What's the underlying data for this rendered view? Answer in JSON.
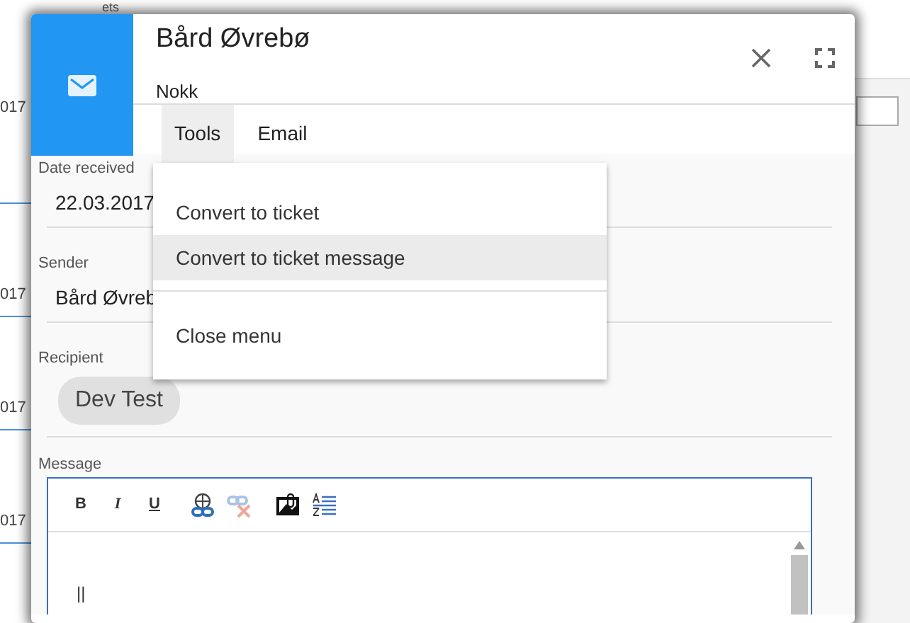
{
  "background": {
    "header_fragment": "ets",
    "row_fragments": [
      "017",
      "017",
      "017",
      "017"
    ]
  },
  "dialog": {
    "title": "Bård Øvrebø",
    "subtitle": "Nokk",
    "tabs": [
      {
        "label": "Tools",
        "selected": true
      },
      {
        "label": "Email",
        "selected": false
      }
    ],
    "fields": [
      {
        "label": "Date received",
        "value": "22.03.2017"
      },
      {
        "label": "Sender",
        "value": "Bård Øvreb"
      }
    ],
    "recipient": {
      "label": "Recipient",
      "chips": [
        "Dev Test"
      ]
    },
    "message": {
      "label": "Message",
      "toolbar": [
        {
          "kind": "bold",
          "text": "B"
        },
        {
          "kind": "italic",
          "text": "I"
        },
        {
          "kind": "underline",
          "text": "U"
        },
        {
          "kind": "link"
        },
        {
          "kind": "unlink"
        },
        {
          "kind": "image"
        },
        {
          "kind": "format"
        }
      ],
      "content": "||"
    }
  },
  "menu": {
    "items": [
      {
        "kind": "item",
        "label": "Convert to ticket",
        "selected": false
      },
      {
        "kind": "item",
        "label": "Convert to ticket message",
        "selected": true
      },
      {
        "kind": "divider"
      },
      {
        "kind": "item",
        "label": "Close menu",
        "selected": false
      }
    ]
  }
}
